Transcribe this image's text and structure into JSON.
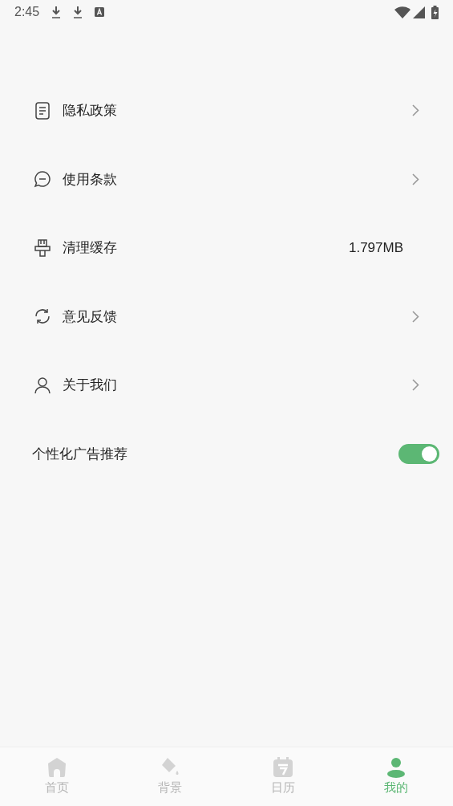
{
  "status_bar": {
    "time": "2:45"
  },
  "settings": [
    {
      "kind": "link",
      "label": "隐私政策"
    },
    {
      "kind": "link",
      "label": "使用条款"
    },
    {
      "kind": "value",
      "label": "清理缓存",
      "value": "1.797MB"
    },
    {
      "kind": "link",
      "label": "意见反馈"
    },
    {
      "kind": "link",
      "label": "关于我们"
    },
    {
      "kind": "toggle",
      "label": "个性化广告推荐",
      "on": true
    }
  ],
  "bottom_nav": [
    {
      "label": "首页",
      "selected": false
    },
    {
      "label": "背景",
      "selected": false
    },
    {
      "label": "日历",
      "selected": false
    },
    {
      "label": "我的",
      "selected": true
    }
  ]
}
